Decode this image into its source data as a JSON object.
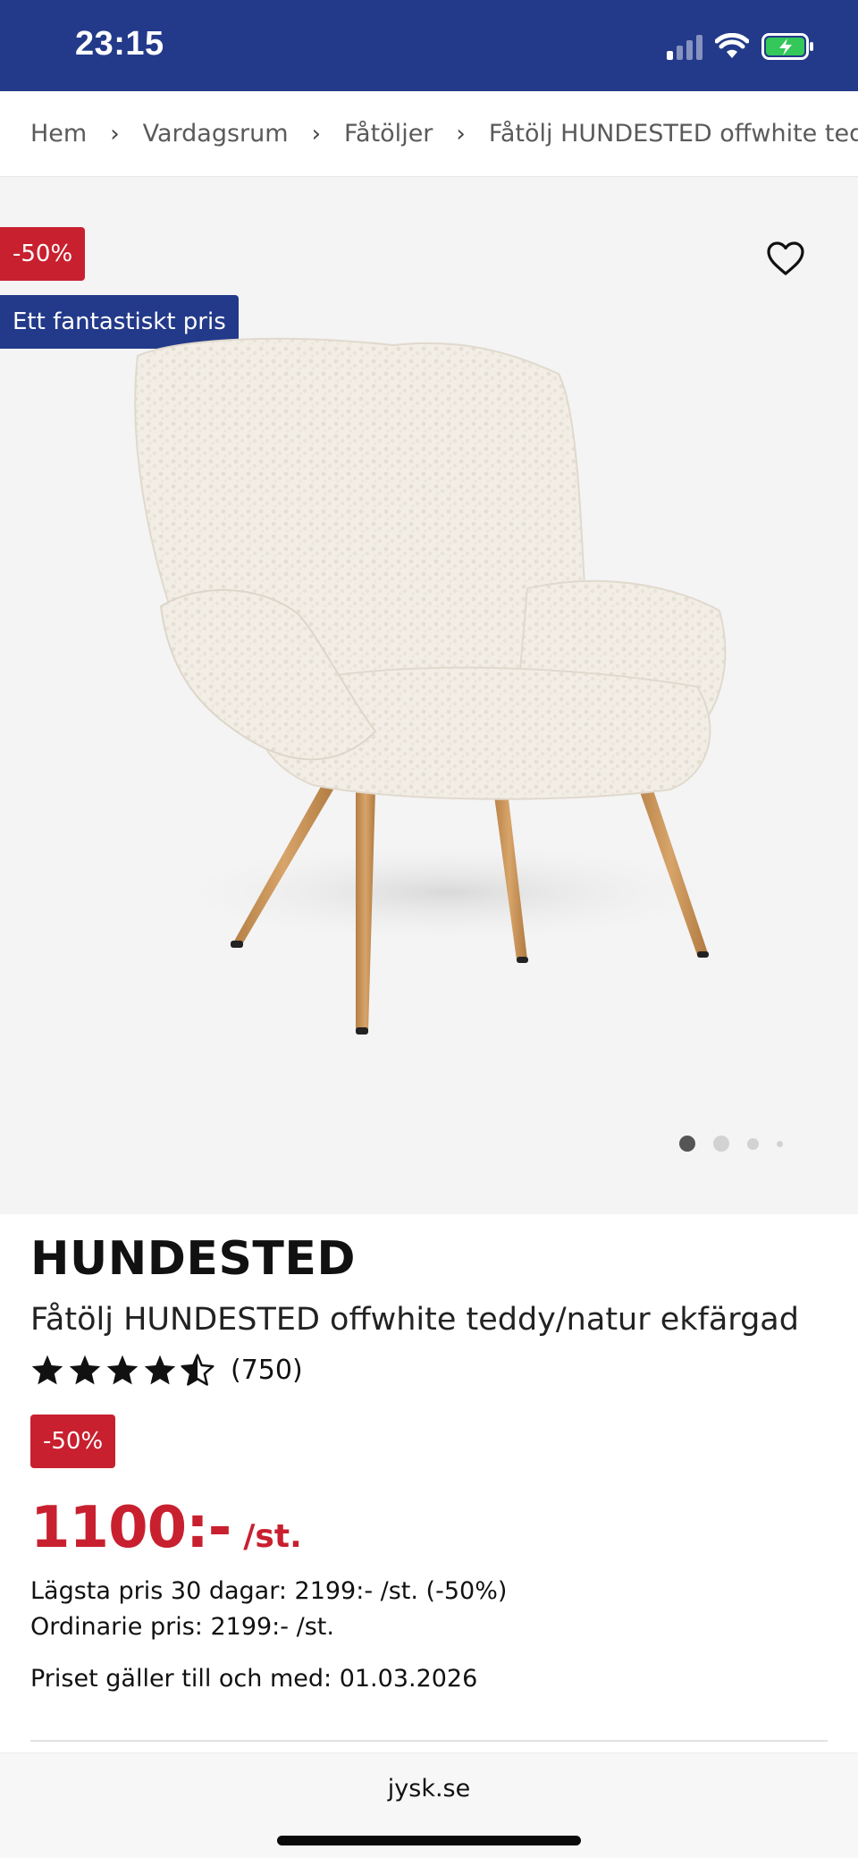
{
  "status_bar": {
    "time": "23:15",
    "icons": [
      "cellular-signal-icon",
      "wifi-icon",
      "battery-charging-icon"
    ],
    "battery_color": "#34c759"
  },
  "breadcrumb": {
    "items": [
      "Hem",
      "Vardagsrum",
      "Fåtöljer",
      "Fåtölj HUNDESTED offwhite tedd"
    ],
    "separator": "›"
  },
  "gallery": {
    "badge_discount": "-50%",
    "badge_deal": "Ett fantastiskt pris",
    "favorite_icon": "heart-outline-icon",
    "image_subject": "chair",
    "slide_count": 4,
    "active_slide": 1
  },
  "product": {
    "brand": "HUNDESTED",
    "name": "Fåtölj HUNDESTED offwhite teddy/natur ekfärgad",
    "rating": 4.5,
    "rating_max": 5,
    "review_count": "(750)",
    "discount_badge": "-50%",
    "price": "1100:-",
    "price_unit": "/st.",
    "lowest_price_30_days": "Lägsta pris 30 dagar: 2199:- /st. (-50%)",
    "regular_price": "Ordinarie pris: 2199:- /st.",
    "price_valid_until": "Priset gäller till och med: 01.03.2026"
  },
  "browser": {
    "url": "jysk.se"
  },
  "colors": {
    "brand_blue": "#233a8a",
    "sale_red": "#c8202f",
    "image_bg": "#f4f4f4"
  }
}
